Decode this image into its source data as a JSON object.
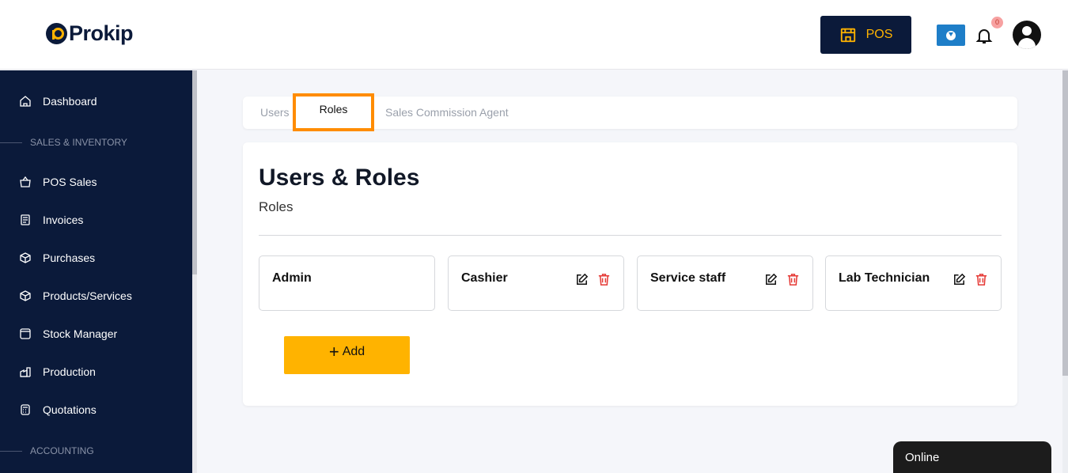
{
  "header": {
    "logo_text": "Prokip",
    "pos_label": "POS",
    "notification_count": "0"
  },
  "sidebar": {
    "items": [
      {
        "label": "Dashboard",
        "icon": "home-icon"
      },
      {
        "label": "POS Sales",
        "icon": "basket-icon"
      },
      {
        "label": "Invoices",
        "icon": "invoice-icon"
      },
      {
        "label": "Purchases",
        "icon": "box-plus-icon"
      },
      {
        "label": "Products/Services",
        "icon": "cube-icon"
      },
      {
        "label": "Stock Manager",
        "icon": "stock-icon"
      },
      {
        "label": "Production",
        "icon": "factory-icon"
      },
      {
        "label": "Quotations",
        "icon": "calculator-icon"
      }
    ],
    "sections": [
      "SALES & INVENTORY",
      "ACCOUNTING"
    ]
  },
  "tabs": [
    {
      "label": "Users",
      "active": false
    },
    {
      "label": "Roles",
      "active": true
    },
    {
      "label": "Sales Commission Agent",
      "active": false
    }
  ],
  "main": {
    "title": "Users & Roles",
    "subtitle": "Roles",
    "roles": [
      {
        "name": "Admin",
        "editable": false
      },
      {
        "name": "Cashier",
        "editable": true
      },
      {
        "name": "Service staff",
        "editable": true
      },
      {
        "name": "Lab Technician",
        "editable": true
      }
    ],
    "add_label": "Add"
  },
  "chat": {
    "status": "Online"
  },
  "colors": {
    "brand_navy": "#0b1a3a",
    "accent_yellow": "#ffb300",
    "delete_red": "#e53935",
    "tab_highlight": "#ff8c00"
  }
}
